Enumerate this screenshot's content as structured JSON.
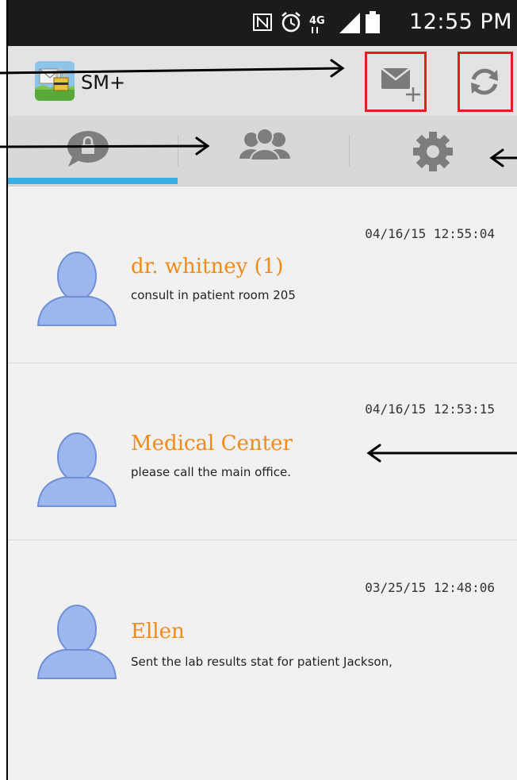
{
  "status_bar": {
    "time": "12:55 PM"
  },
  "app_bar": {
    "title": "SM+"
  },
  "tabs": [
    {
      "name": "locked-messages"
    },
    {
      "name": "contacts"
    },
    {
      "name": "settings"
    }
  ],
  "messages": [
    {
      "timestamp": "04/16/15 12:55:04",
      "sender": "dr. whitney (1)",
      "preview": "consult in patient room 205"
    },
    {
      "timestamp": "04/16/15 12:53:15",
      "sender": "Medical Center",
      "preview": "please call the main office."
    },
    {
      "timestamp": "03/25/15 12:48:06",
      "sender": "Ellen",
      "preview": "Sent the lab results stat for patient Jackson,"
    }
  ],
  "colors": {
    "accent_tab": "#39aee6",
    "sender_name": "#f28a1b",
    "highlight_box": "#e02020"
  }
}
